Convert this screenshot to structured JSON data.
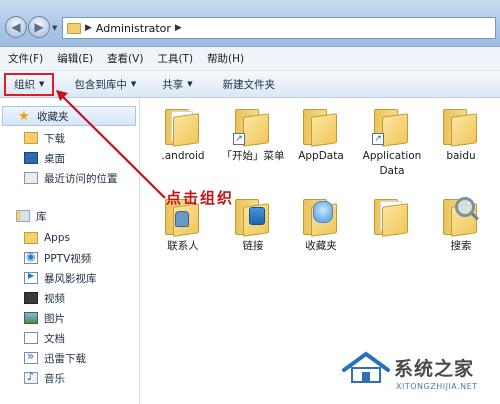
{
  "window": {
    "address_segment": "Administrator"
  },
  "menubar": [
    {
      "label": "文件(F)"
    },
    {
      "label": "编辑(E)"
    },
    {
      "label": "查看(V)"
    },
    {
      "label": "工具(T)"
    },
    {
      "label": "帮助(H)"
    }
  ],
  "commandbar": {
    "organize": "组织",
    "include_in_library": "包含到库中",
    "share": "共享",
    "new_folder": "新建文件夹"
  },
  "sidebar": {
    "favorites": "收藏夹",
    "favorites_items": [
      {
        "label": "下载",
        "icon": "download-folder-icon"
      },
      {
        "label": "桌面",
        "icon": "desktop-icon"
      },
      {
        "label": "最近访问的位置",
        "icon": "recent-places-icon"
      }
    ],
    "libraries": "库",
    "library_items": [
      {
        "label": "Apps",
        "icon": "folder-icon"
      },
      {
        "label": "PPTV视频",
        "icon": "pptv-icon"
      },
      {
        "label": "暴风影视库",
        "icon": "storm-video-icon"
      },
      {
        "label": "视频",
        "icon": "video-icon"
      },
      {
        "label": "图片",
        "icon": "pictures-icon"
      },
      {
        "label": "文档",
        "icon": "documents-icon"
      },
      {
        "label": "迅雷下载",
        "icon": "thunder-icon"
      },
      {
        "label": "音乐",
        "icon": "music-icon"
      }
    ]
  },
  "files": [
    {
      "name": ".android",
      "type": "folder"
    },
    {
      "name": "「开始」菜单",
      "type": "folder-shortcut"
    },
    {
      "name": "AppData",
      "type": "folder"
    },
    {
      "name": "Application Data",
      "type": "folder-shortcut"
    },
    {
      "name": "baidu",
      "type": "folder"
    },
    {
      "name": "联系人",
      "type": "contacts"
    },
    {
      "name": "链接",
      "type": "links"
    },
    {
      "name": "收藏夹",
      "type": "favorites"
    },
    {
      "name": "",
      "type": "documents-folder"
    },
    {
      "name": "搜索",
      "type": "searches"
    }
  ],
  "annotation": {
    "text": "点击组织",
    "color": "#c3141c"
  },
  "watermark": {
    "title": "系统之家",
    "url": "XITONGZHIJIA.NET"
  }
}
